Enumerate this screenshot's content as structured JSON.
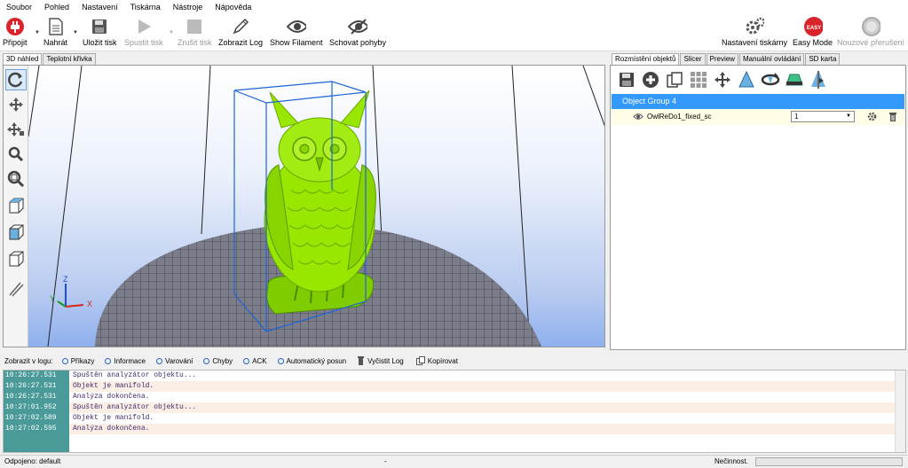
{
  "menu": [
    "Soubor",
    "Pohled",
    "Nastavení",
    "Tiskárna",
    "Nástroje",
    "Nápověda"
  ],
  "toolbar": {
    "connect": "Připojit",
    "load": "Nahrát",
    "save_print": "Uložit tisk",
    "start_print": "Spustit tisk",
    "cancel_print": "Zrušit tisk",
    "show_log": "Zobrazit Log",
    "show_filament": "Show Filament",
    "hide_moves": "Schovat pohyby",
    "printer_settings": "Nastavení tiskárny",
    "easy_mode": "Easy Mode",
    "easy_badge": "EASY",
    "emergency_stop": "Nouzové přerušení"
  },
  "left_tabs": [
    "3D náhled",
    "Teplotní křivka"
  ],
  "right_tabs": [
    "Rozmístění objektů",
    "Slicer",
    "Preview",
    "Manuální ovládání",
    "SD karta"
  ],
  "axes": {
    "x": "X",
    "y": "Y",
    "z": "Z"
  },
  "object_panel": {
    "group_name": "Object Group 4",
    "object_name": "OwlReDo1_fixed_sc",
    "copies": "1"
  },
  "log": {
    "show_label": "Zobrazit v logu:",
    "filters": [
      "Příkazy",
      "Informace",
      "Varování",
      "Chyby",
      "ACK",
      "Automatický posun"
    ],
    "clear": "Vyčistit Log",
    "copy": "Kopírovat",
    "rows": [
      {
        "time": "10:26:27.531",
        "msg": "Spuštěn analyzátor objektu..."
      },
      {
        "time": "10:26:27.531",
        "msg": "Objekt je manifold."
      },
      {
        "time": "10:26:27.531",
        "msg": "Analýza dokončena."
      },
      {
        "time": "10:27:01.952",
        "msg": "Spuštěn analyzátor objektu..."
      },
      {
        "time": "10:27:02.589",
        "msg": "Objekt je manifold."
      },
      {
        "time": "10:27:02.595",
        "msg": "Analýza dokončena."
      }
    ]
  },
  "status": {
    "connection": "Odpojeno: default",
    "middle": "-",
    "state": "Nečinnost."
  },
  "colors": {
    "accent": "#3399ff",
    "model": "#99e600",
    "log_time_bg": "#4a9a9a",
    "easy_red": "#d8242a"
  }
}
